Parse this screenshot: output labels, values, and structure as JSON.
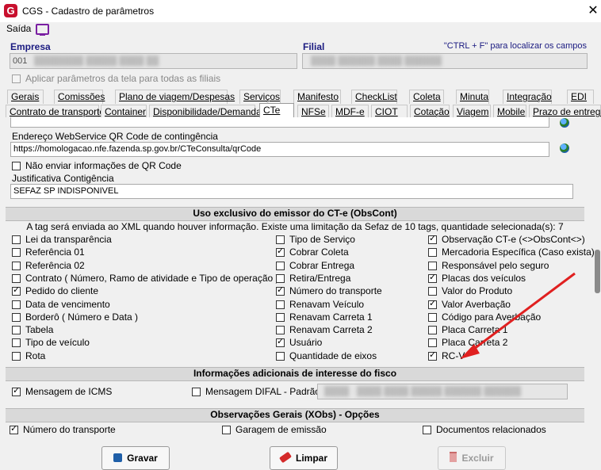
{
  "window": {
    "logo_letter": "G",
    "title": "CGS - Cadastro de parâmetros",
    "close": "✕"
  },
  "toolbar": {
    "saida_label": "Saída"
  },
  "empresa": {
    "label": "Empresa",
    "value": "001"
  },
  "filial": {
    "label": "Filial"
  },
  "hint": "\"CTRL + F\" para localizar os campos",
  "apply_all": {
    "label": "Aplicar parâmetros da tela para todas as filiais",
    "checked": false
  },
  "tabs_row1": [
    "Gerais",
    "Comissões",
    "Plano de viagem/Despesas",
    "Serviços",
    "Manifesto",
    "CheckList",
    "Coleta",
    "Minuta",
    "Integração",
    "EDI"
  ],
  "tabs_row2": [
    "Contrato de transporte",
    "Container",
    "Disponibilidade/Demanda",
    "CTe",
    "NFSe",
    "MDF-e",
    "CIOT",
    "Cotação",
    "Viagem",
    "Mobile",
    "Prazo de entrega"
  ],
  "selected_tab": "CTe",
  "qr": {
    "contingency_label": "Endereço WebService QR Code de contingência",
    "contingency_url": "https://homologacao.nfe.fazenda.sp.gov.br/CTeConsulta/qrCode",
    "no_send_label": "Não enviar informações de QR Code",
    "justification_label": "Justificativa Contigência",
    "justification_value": "SEFAZ SP INDISPONIVEL"
  },
  "obscont": {
    "header": "Uso exclusivo do emissor do CT-e (ObsCont)",
    "info": "A tag será enviada ao XML quando houver informação. Existe uma limitação da Sefaz de 10 tags, quantidade selecionada(s): 7",
    "col1": [
      {
        "label": "Lei da transparência",
        "checked": false
      },
      {
        "label": "Referência 01",
        "checked": false
      },
      {
        "label": "Referência 02",
        "checked": false
      },
      {
        "label": "Contrato ( Número, Ramo de atividade e Tipo de operação )",
        "checked": false
      },
      {
        "label": "Pedido do cliente",
        "checked": true
      },
      {
        "label": "Data de vencimento",
        "checked": false
      },
      {
        "label": "Borderô ( Número e Data )",
        "checked": false
      },
      {
        "label": "Tabela",
        "checked": false
      },
      {
        "label": "Tipo de veículo",
        "checked": false
      },
      {
        "label": "Rota",
        "checked": false
      }
    ],
    "col2": [
      {
        "label": "Tipo de Serviço",
        "checked": false
      },
      {
        "label": "Cobrar Coleta",
        "checked": true
      },
      {
        "label": "Cobrar Entrega",
        "checked": false
      },
      {
        "label": "Retira/Entrega",
        "checked": false
      },
      {
        "label": "Número do transporte",
        "checked": true
      },
      {
        "label": "Renavam Veículo",
        "checked": false
      },
      {
        "label": "Renavam Carreta 1",
        "checked": false
      },
      {
        "label": "Renavam Carreta 2",
        "checked": false
      },
      {
        "label": "Usuário",
        "checked": true
      },
      {
        "label": "Quantidade de eixos",
        "checked": false
      }
    ],
    "col3": [
      {
        "label": "Observação CT-e (<>ObsCont<>)",
        "checked": true
      },
      {
        "label": "Mercadoria Específica (Caso exista)",
        "checked": false
      },
      {
        "label": "Responsável pelo seguro",
        "checked": false
      },
      {
        "label": "Placas dos veículos",
        "checked": true
      },
      {
        "label": "Valor do Produto",
        "checked": false
      },
      {
        "label": "Valor Averbação",
        "checked": true
      },
      {
        "label": "Código para Averbação",
        "checked": false
      },
      {
        "label": "Placa Carreta 1",
        "checked": false
      },
      {
        "label": "Placa Carreta 2",
        "checked": false
      },
      {
        "label": "RC-V",
        "checked": true
      }
    ]
  },
  "fisco": {
    "header": "Informações adicionais de interesse do fisco",
    "icms_label": "Mensagem de ICMS",
    "icms_checked": true,
    "difal_label": "Mensagem DIFAL - Padrão",
    "difal_checked": false
  },
  "xobs": {
    "header": "Observações Gerais (XObs) - Opções",
    "items": [
      {
        "label": "Número do transporte",
        "checked": true
      },
      {
        "label": "Garagem de emissão",
        "checked": false
      },
      {
        "label": "Documentos relacionados",
        "checked": false
      }
    ]
  },
  "buttons": {
    "save": "Gravar",
    "clear": "Limpar",
    "delete": "Excluir"
  },
  "colors": {
    "logo": "#c8102e",
    "arrow": "#e02020",
    "section_header": "#d9d9d9",
    "label_blue": "#1a1a80"
  }
}
